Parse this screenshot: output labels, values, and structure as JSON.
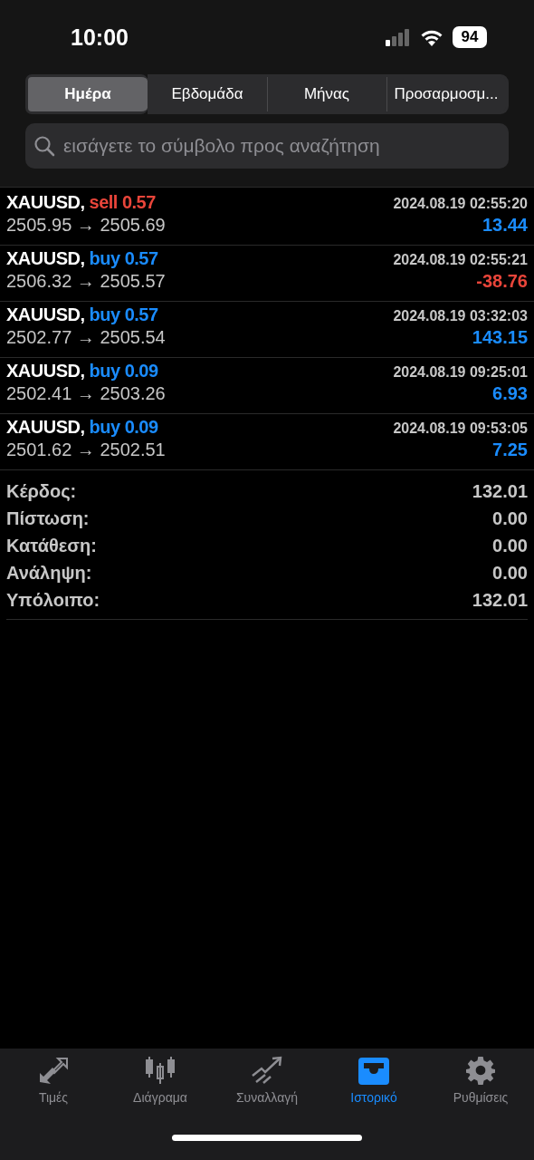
{
  "status_bar": {
    "time": "10:00",
    "battery": "94"
  },
  "period_tabs": [
    {
      "label": "Ημέρα",
      "selected": true
    },
    {
      "label": "Εβδομάδα",
      "selected": false
    },
    {
      "label": "Μήνας",
      "selected": false
    },
    {
      "label": "Προσαρμοσμ...",
      "selected": false
    }
  ],
  "search": {
    "placeholder": "εισάγετε το σύμβολο προς αναζήτηση"
  },
  "deals": [
    {
      "symbol": "XAUUSD,",
      "kind": "sell",
      "deal": "sell 0.57",
      "time": "2024.08.19 02:55:20",
      "prices": "2505.95 → 2505.69",
      "profit": "13.44",
      "loss": false
    },
    {
      "symbol": "XAUUSD,",
      "kind": "buy",
      "deal": "buy 0.57",
      "time": "2024.08.19 02:55:21",
      "prices": "2506.32 → 2505.57",
      "profit": "-38.76",
      "loss": true
    },
    {
      "symbol": "XAUUSD,",
      "kind": "buy",
      "deal": "buy 0.57",
      "time": "2024.08.19 03:32:03",
      "prices": "2502.77 → 2505.54",
      "profit": "143.15",
      "loss": false
    },
    {
      "symbol": "XAUUSD,",
      "kind": "buy",
      "deal": "buy 0.09",
      "time": "2024.08.19 09:25:01",
      "prices": "2502.41 → 2503.26",
      "profit": "6.93",
      "loss": false
    },
    {
      "symbol": "XAUUSD,",
      "kind": "buy",
      "deal": "buy 0.09",
      "time": "2024.08.19 09:53:05",
      "prices": "2501.62 → 2502.51",
      "profit": "7.25",
      "loss": false
    }
  ],
  "summary": [
    {
      "label": "Κέρδος:",
      "value": "132.01"
    },
    {
      "label": "Πίστωση:",
      "value": "0.00"
    },
    {
      "label": "Κατάθεση:",
      "value": "0.00"
    },
    {
      "label": "Ανάληψη:",
      "value": "0.00"
    },
    {
      "label": "Υπόλοιπο:",
      "value": "132.01"
    }
  ],
  "tab_bar": [
    {
      "label": "Τιμές",
      "kind": "arrows",
      "selected": false
    },
    {
      "label": "Διάγραμα",
      "kind": "candles",
      "selected": false
    },
    {
      "label": "Συναλλαγή",
      "kind": "trend",
      "selected": false
    },
    {
      "label": "Ιστορικό",
      "kind": "tray",
      "selected": true
    },
    {
      "label": "Ρυθμίσεις",
      "kind": "gear",
      "selected": false
    }
  ]
}
